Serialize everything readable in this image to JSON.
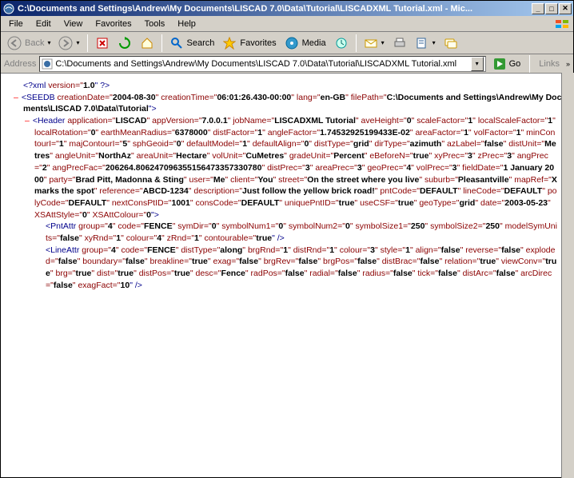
{
  "title": "C:\\Documents and Settings\\Andrew\\My Documents\\LISCAD 7.0\\Data\\Tutorial\\LISCADXML Tutorial.xml - Mic...",
  "menu": [
    "File",
    "Edit",
    "View",
    "Favorites",
    "Tools",
    "Help"
  ],
  "toolbar": {
    "back": "Back",
    "search": "Search",
    "favorites": "Favorites",
    "media": "Media"
  },
  "addressbar": {
    "label": "Address",
    "value": "C:\\Documents and Settings\\Andrew\\My Documents\\LISCAD 7.0\\Data\\Tutorial\\LISCADXML Tutorial.xml",
    "go": "Go",
    "links": "Links"
  },
  "xml": {
    "decl": {
      "open": "<?xml ",
      "a1n": "version=\"",
      "a1v": "1.0",
      "close": "\" ?>"
    },
    "seedb": {
      "open": "<SEEDB ",
      "a1n": "creationDate=\"",
      "a1v": "2004-08-30",
      "a2n": "\" creationTime=\"",
      "a2v": "06:01:26.430-00:00",
      "a3n": "\" lang=\"",
      "a3v": "en-GB",
      "a4n": "\" filePath=\"",
      "a4v": "C:\\Documents and Settings\\Andrew\\My Documents\\LISCAD 7.0\\Data\\Tutorial",
      "close": "\">"
    },
    "header": {
      "open": "<Header ",
      "attrs": [
        {
          "n": "application=\"",
          "v": "LISCAD"
        },
        {
          "n": "\" appVersion=\"",
          "v": "7.0.0.1"
        },
        {
          "n": "\" jobName=\"",
          "v": "LISCADXML Tutorial"
        },
        {
          "n": "\" aveHeight=\"",
          "v": "0"
        },
        {
          "n": "\" scaleFactor=\"",
          "v": "1"
        },
        {
          "n": "\" localScaleFactor=\"",
          "v": "1"
        },
        {
          "n": "\" localRotation=\"",
          "v": "0"
        },
        {
          "n": "\" earthMeanRadius=\"",
          "v": "6378000"
        },
        {
          "n": "\" distFactor=\"",
          "v": "1"
        },
        {
          "n": "\" angleFactor=\"",
          "v": "1.74532925199433E-02"
        },
        {
          "n": "\" areaFactor=\"",
          "v": "1"
        },
        {
          "n": "\" volFactor=\"",
          "v": "1"
        },
        {
          "n": "\" minContourI=\"",
          "v": "1"
        },
        {
          "n": "\" majContourI=\"",
          "v": "5"
        },
        {
          "n": "\" sphGeoid=\"",
          "v": "0"
        },
        {
          "n": "\" defaultModel=\"",
          "v": "1"
        },
        {
          "n": "\" defaultAlign=\"",
          "v": "0"
        },
        {
          "n": "\" distType=\"",
          "v": "grid"
        },
        {
          "n": "\" dirType=\"",
          "v": "azimuth"
        },
        {
          "n": "\" azLabel=\"",
          "v": "false"
        },
        {
          "n": "\" distUnit=\"",
          "v": "Metres"
        },
        {
          "n": "\" angleUnit=\"",
          "v": "NorthAz"
        },
        {
          "n": "\" areaUnit=\"",
          "v": "Hectare"
        },
        {
          "n": "\" volUnit=\"",
          "v": "CuMetres"
        },
        {
          "n": "\" gradeUnit=\"",
          "v": "Percent"
        },
        {
          "n": "\" eBeforeN=\"",
          "v": "true"
        },
        {
          "n": "\" xyPrec=\"",
          "v": "3"
        },
        {
          "n": "\" zPrec=\"",
          "v": "3"
        },
        {
          "n": "\" angPrec=\"",
          "v": "2"
        },
        {
          "n": "\" angPrecFac=\"",
          "v": "206264.806247096355156473357330780"
        },
        {
          "n": "\" distPrec=\"",
          "v": "3"
        },
        {
          "n": "\" areaPrec=\"",
          "v": "3"
        },
        {
          "n": "\" geoPrec=\"",
          "v": "4"
        },
        {
          "n": "\" volPrec=\"",
          "v": "3"
        },
        {
          "n": "\" fieldDate=\"",
          "v": "1 January 2000"
        },
        {
          "n": "\" party=\"",
          "v": "Brad Pitt, Madonna & Sting"
        },
        {
          "n": "\" user=\"",
          "v": "Me"
        },
        {
          "n": "\" client=\"",
          "v": "You"
        },
        {
          "n": "\" street=\"",
          "v": "On the street where you live"
        },
        {
          "n": "\" suburb=\"",
          "v": "Pleasantville"
        },
        {
          "n": "\" mapRef=\"",
          "v": "X marks the spot"
        },
        {
          "n": "\" reference=\"",
          "v": "ABCD-1234"
        },
        {
          "n": "\" description=\"",
          "v": "Just follow the yellow brick road!"
        },
        {
          "n": "\" pntCode=\"",
          "v": "DEFAULT"
        },
        {
          "n": "\" lineCode=\"",
          "v": "DEFAULT"
        },
        {
          "n": "\" polyCode=\"",
          "v": "DEFAULT"
        },
        {
          "n": "\" nextConsPtID=\"",
          "v": "1001"
        },
        {
          "n": "\" consCode=\"",
          "v": "DEFAULT"
        },
        {
          "n": "\" uniquePntID=\"",
          "v": "true"
        },
        {
          "n": "\" useCSF=\"",
          "v": "true"
        },
        {
          "n": "\" geoType=\"",
          "v": "grid"
        },
        {
          "n": "\" date=\"",
          "v": "2003-05-23"
        },
        {
          "n": "\" XSAttStyle=\"",
          "v": "0"
        },
        {
          "n": "\" XSAttColour=\"",
          "v": "0"
        }
      ],
      "close": "\">"
    },
    "pntattr": {
      "open": "<PntAttr ",
      "attrs": [
        {
          "n": "group=\"",
          "v": "4"
        },
        {
          "n": "\" code=\"",
          "v": "FENCE"
        },
        {
          "n": "\" symDir=\"",
          "v": "0"
        },
        {
          "n": "\" symbolNum1=\"",
          "v": "0"
        },
        {
          "n": "\" symbolNum2=\"",
          "v": "0"
        },
        {
          "n": "\" symbolSize1=\"",
          "v": "250"
        },
        {
          "n": "\" symbolSize2=\"",
          "v": "250"
        },
        {
          "n": "\" modelSymUnits=\"",
          "v": "false"
        },
        {
          "n": "\" xyRnd=\"",
          "v": "1"
        },
        {
          "n": "\" colour=\"",
          "v": "4"
        },
        {
          "n": "\" zRnd=\"",
          "v": "1"
        },
        {
          "n": "\" contourable=\"",
          "v": "true"
        }
      ],
      "close": "\" />"
    },
    "lineattr": {
      "open": "<LineAttr ",
      "attrs": [
        {
          "n": "group=\"",
          "v": "4"
        },
        {
          "n": "\" code=\"",
          "v": "FENCE"
        },
        {
          "n": "\" distType=\"",
          "v": "along"
        },
        {
          "n": "\" brgRnd=\"",
          "v": "1"
        },
        {
          "n": "\" distRnd=\"",
          "v": "1"
        },
        {
          "n": "\" colour=\"",
          "v": "3"
        },
        {
          "n": "\" style=\"",
          "v": "1"
        },
        {
          "n": "\" align=\"",
          "v": "false"
        },
        {
          "n": "\" reverse=\"",
          "v": "false"
        },
        {
          "n": "\" exploded=\"",
          "v": "false"
        },
        {
          "n": "\" boundary=\"",
          "v": "false"
        },
        {
          "n": "\" breakline=\"",
          "v": "true"
        },
        {
          "n": "\" exag=\"",
          "v": "false"
        },
        {
          "n": "\" brgRev=\"",
          "v": "false"
        },
        {
          "n": "\" brgPos=\"",
          "v": "false"
        },
        {
          "n": "\" distBrac=\"",
          "v": "false"
        },
        {
          "n": "\" relation=\"",
          "v": "true"
        },
        {
          "n": "\" viewConv=\"",
          "v": "true"
        },
        {
          "n": "\" brg=\"",
          "v": "true"
        },
        {
          "n": "\" dist=\"",
          "v": "true"
        },
        {
          "n": "\" distPos=\"",
          "v": "true"
        },
        {
          "n": "\" desc=\"",
          "v": "Fence"
        },
        {
          "n": "\" radPos=\"",
          "v": "false"
        },
        {
          "n": "\" radial=\"",
          "v": "false"
        },
        {
          "n": "\" radius=\"",
          "v": "false"
        },
        {
          "n": "\" tick=\"",
          "v": "false"
        },
        {
          "n": "\" distArc=\"",
          "v": "false"
        },
        {
          "n": "\" arcDirec=\"",
          "v": "false"
        },
        {
          "n": "\" exagFact=\"",
          "v": "10"
        }
      ],
      "close": "\" />"
    }
  }
}
